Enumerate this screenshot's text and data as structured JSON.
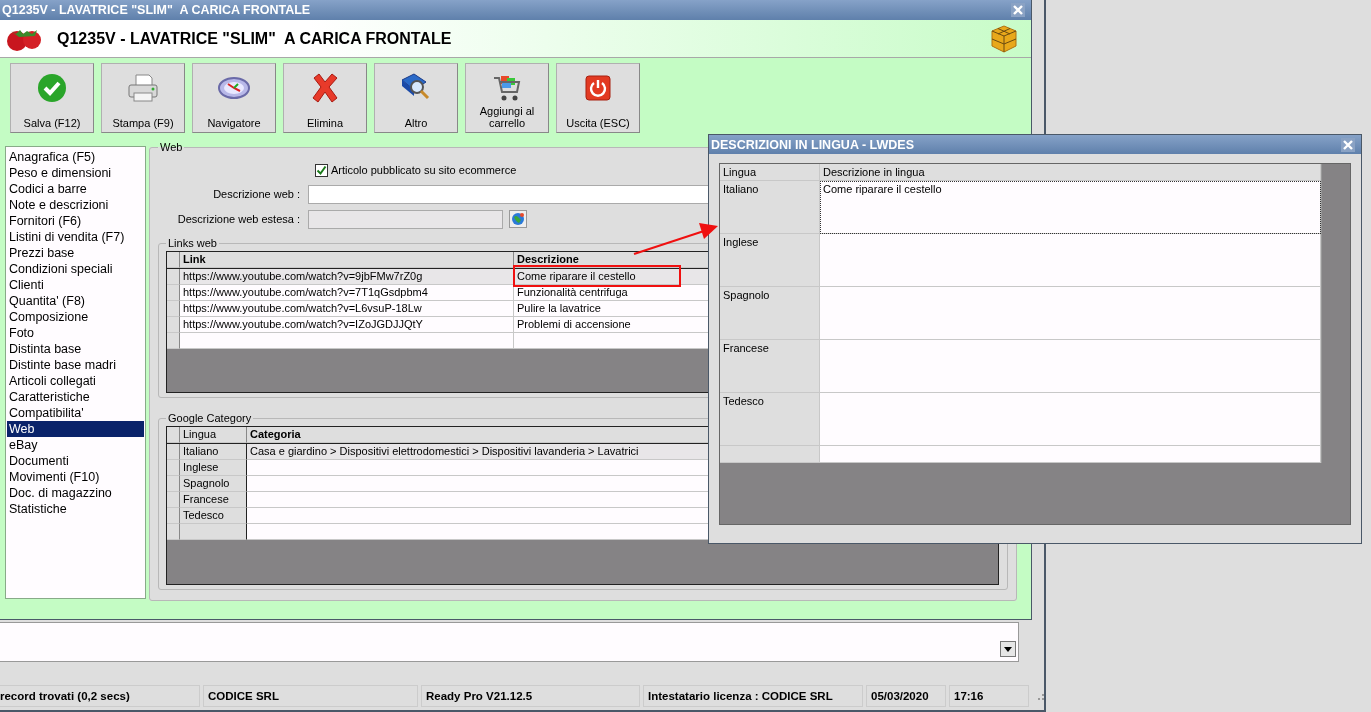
{
  "window": {
    "title": "Q1235V - LAVATRICE \"SLIM\"  A CARICA FRONTALE"
  },
  "header": {
    "title": "Q1235V - LAVATRICE \"SLIM\"  A CARICA FRONTALE"
  },
  "toolbar": [
    {
      "label": "Salva (F12)"
    },
    {
      "label": "Stampa (F9)"
    },
    {
      "label": "Navigatore"
    },
    {
      "label": "Elimina"
    },
    {
      "label": "Altro"
    },
    {
      "label": "Aggiungi al carrello"
    },
    {
      "label": "Uscita (ESC)"
    }
  ],
  "sidebar": {
    "items": [
      {
        "label": "Anagrafica (F5)",
        "selected": false
      },
      {
        "label": "Peso e dimensioni",
        "selected": false
      },
      {
        "label": "Codici a barre",
        "selected": false
      },
      {
        "label": "Note e descrizioni",
        "selected": false
      },
      {
        "label": "Fornitori (F6)",
        "selected": false
      },
      {
        "label": "Listini di vendita (F7)",
        "selected": false
      },
      {
        "label": "Prezzi base",
        "selected": false
      },
      {
        "label": "Condizioni speciali",
        "selected": false
      },
      {
        "label": "Clienti",
        "selected": false
      },
      {
        "label": "Quantita' (F8)",
        "selected": false
      },
      {
        "label": "Composizione",
        "selected": false
      },
      {
        "label": "Foto",
        "selected": false
      },
      {
        "label": "Distinta base",
        "selected": false
      },
      {
        "label": "Distinte base madri",
        "selected": false
      },
      {
        "label": "Articoli collegati",
        "selected": false
      },
      {
        "label": "Caratteristiche",
        "selected": false
      },
      {
        "label": "Compatibilita'",
        "selected": false
      },
      {
        "label": "Web",
        "selected": true
      },
      {
        "label": "eBay",
        "selected": false
      },
      {
        "label": "Documenti",
        "selected": false
      },
      {
        "label": "Movimenti (F10)",
        "selected": false
      },
      {
        "label": "Doc. di magazzino",
        "selected": false
      },
      {
        "label": "Statistiche",
        "selected": false
      }
    ]
  },
  "web": {
    "title": "Web",
    "published": {
      "label": "Articolo pubblicato su sito ecommerce",
      "checked": true
    },
    "fields": [
      {
        "label": "Descrizione web :",
        "disabled": false
      },
      {
        "label": "Descrizione web estesa :",
        "disabled": true
      }
    ],
    "links": {
      "title": "Links web",
      "columns": [
        "Link",
        "Descrizione"
      ],
      "rows": [
        {
          "link": "https://www.youtube.com/watch?v=9jbFMw7rZ0g",
          "description": "Come riparare il cestello",
          "selected": true
        },
        {
          "link": "https://www.youtube.com/watch?v=7T1qGsdpbm4",
          "description": "Funzionalità centrifuga",
          "selected": false
        },
        {
          "link": "https://www.youtube.com/watch?v=L6vsuP-18Lw",
          "description": "Pulire la lavatrice",
          "selected": false
        },
        {
          "link": "https://www.youtube.com/watch?v=IZoJGDJJQtY",
          "description": "Problemi di accensione",
          "selected": false
        }
      ]
    },
    "google_category": {
      "title": "Google Category",
      "columns": [
        "Lingua",
        "Categoria"
      ],
      "rows": [
        {
          "language": "Italiano",
          "category": "Casa e giardino > Dispositivi elettrodomestici > Dispositivi lavanderia > Lavatrici",
          "selected": true
        },
        {
          "language": "Inglese",
          "selected": false
        },
        {
          "language": "Spagnolo",
          "selected": false
        },
        {
          "language": "Francese",
          "selected": false
        },
        {
          "language": "Tedesco",
          "selected": false
        }
      ]
    }
  },
  "dialog": {
    "title": "DESCRIZIONI IN LINGUA - LWDES",
    "columns": [
      "Lingua",
      "Descrizione in lingua"
    ],
    "rows": [
      {
        "language": "Italiano",
        "description": "Come riparare il cestello",
        "focused": true
      },
      {
        "language": "Inglese",
        "focused": false
      },
      {
        "language": "Spagnolo",
        "focused": false
      },
      {
        "language": "Francese",
        "focused": false
      },
      {
        "language": "Tedesco",
        "focused": false
      }
    ]
  },
  "status_bar": [
    "record trovati (0,2 secs)",
    "CODICE SRL",
    "Ready Pro V21.12.5",
    "Intestatario licenza : CODICE SRL",
    "05/03/2020",
    "17:16"
  ]
}
